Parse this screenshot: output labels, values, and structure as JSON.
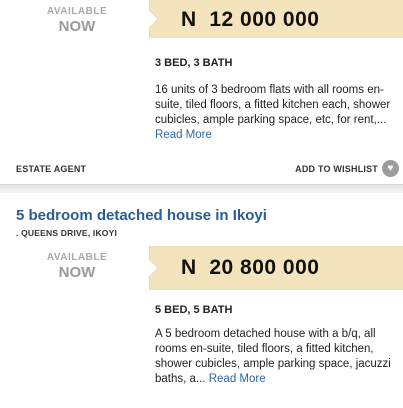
{
  "listing1": {
    "availability_top": "AVAILABLE",
    "availability_now": "NOW",
    "price": "N  12 000 000",
    "beds": "3 BED, 3 BATH",
    "description": "16 units of 3 bedroom flats with all rooms en-suite, tiled floors, a fitted kitchen each, shower cubicles, ample parking space, etc, for rent,...",
    "read_more": "Read More",
    "agent_label": "ESTATE AGENT",
    "wishlist_label": "ADD TO WISHLIST"
  },
  "listing2": {
    "title": "5 bedroom detached house in Ikoyi",
    "location": ". QUEENS DRIVE, IKOYI",
    "availability_top": "AVAILABLE",
    "availability_now": "NOW",
    "price": "N  20 800 000",
    "beds": "5 BED, 5 BATH",
    "description": "A 5 bedroom detached house with a b/q, all rooms en-suite, tiled floors, a fitted kitchen, shower cubicles, ample parking space, jacuzzi baths, a...",
    "read_more": "Read More"
  },
  "icons": {
    "wishlist": "heart-icon"
  },
  "colors": {
    "price_background": "#f4e4bd",
    "title_link": "#2a5d90",
    "read_more_link": "#2e68a3"
  }
}
